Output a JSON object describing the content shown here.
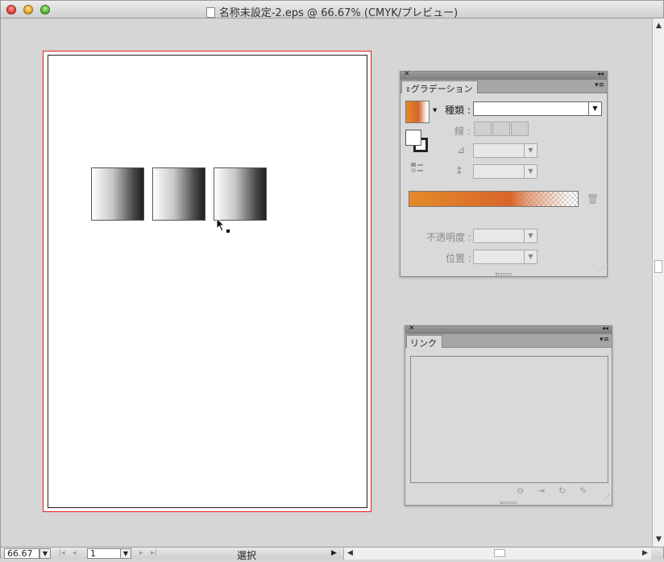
{
  "window": {
    "title": "名称未設定-2.eps @ 66.67% (CMYK/プレビュー)"
  },
  "statusbar": {
    "zoom": "66.67",
    "page": "1",
    "status": "選択"
  },
  "gradient_panel": {
    "tab_label": "グラデーション",
    "type_label": "種類 :",
    "type_value": "",
    "stroke_label": "線 :",
    "opacity_label": "不透明度 :",
    "position_label": "位置 :"
  },
  "links_panel": {
    "tab_label": "リンク"
  },
  "colors": {
    "bleed_red": "#e02020",
    "gradient_orange": "#d8662a"
  }
}
